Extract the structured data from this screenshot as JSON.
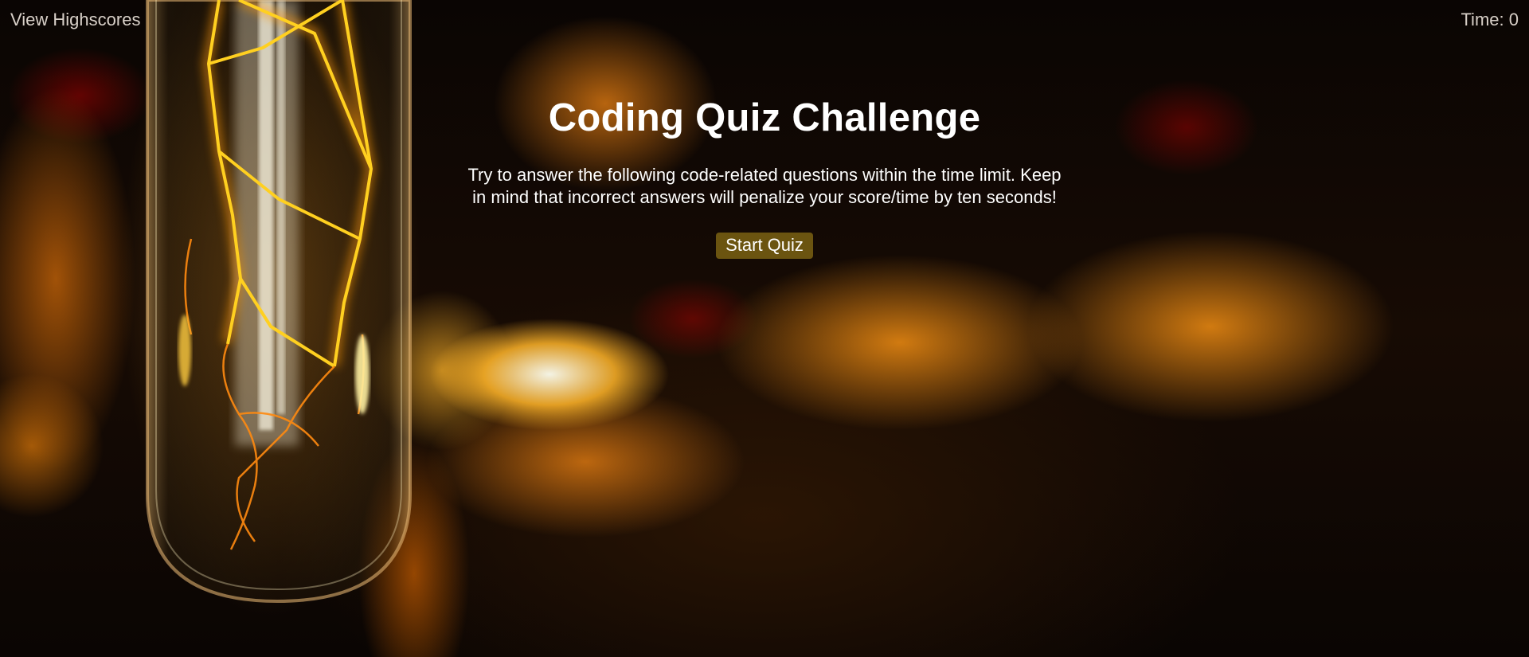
{
  "header": {
    "highscores_link": "View Highscores",
    "timer_label": "Time:",
    "timer_value": "0"
  },
  "main": {
    "title": "Coding Quiz Challenge",
    "description": "Try to answer the following code-related questions within the time limit. Keep in mind that incorrect answers will penalize your score/time by ten seconds!",
    "start_button": "Start Quiz"
  },
  "colors": {
    "button_bg": "#6b5410",
    "text": "#ffffff",
    "header_text": "#d8d0c8",
    "accent_glow": "#ff9a14"
  },
  "background": {
    "image_icon": "filament-bulb-image"
  }
}
